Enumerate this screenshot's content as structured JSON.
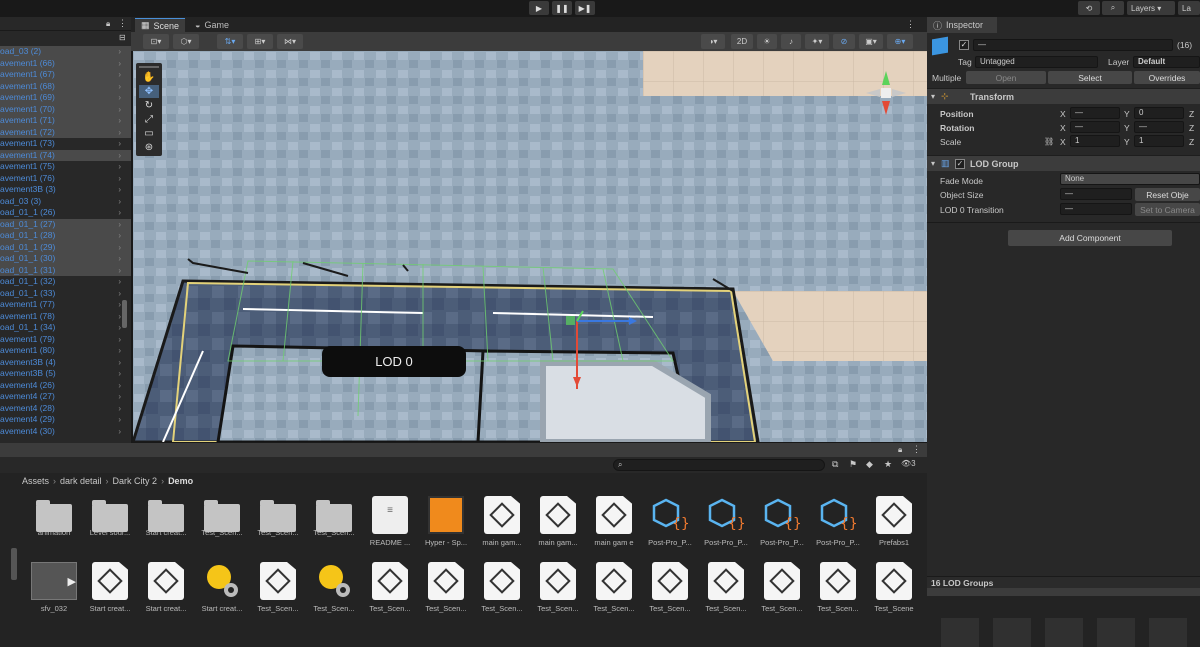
{
  "scene": {
    "tab_scene": "Scene",
    "tab_game": "Game",
    "lod_badge": "LOD 0",
    "btn_2d": "2D"
  },
  "toolbar": {
    "layers": "Layers",
    "layout": "La"
  },
  "hierarchy": {
    "items": [
      {
        "label": "oad_03 (2)",
        "sel": true
      },
      {
        "label": "avement1 (66)",
        "sel": true
      },
      {
        "label": "avement1 (67)",
        "sel": true
      },
      {
        "label": "avement1 (68)",
        "sel": true
      },
      {
        "label": "avement1 (69)",
        "sel": true
      },
      {
        "label": "avement1 (70)",
        "sel": true
      },
      {
        "label": "avement1 (71)",
        "sel": true
      },
      {
        "label": "avement1 (72)",
        "sel": true
      },
      {
        "label": "avement1 (73)",
        "sel": false
      },
      {
        "label": "avement1 (74)",
        "sel": true
      },
      {
        "label": "avement1 (75)",
        "sel": false
      },
      {
        "label": "avement1 (76)",
        "sel": false
      },
      {
        "label": "avement3B (3)",
        "sel": false
      },
      {
        "label": "oad_03 (3)",
        "sel": false
      },
      {
        "label": "oad_01_1 (26)",
        "sel": false
      },
      {
        "label": "oad_01_1 (27)",
        "sel": true
      },
      {
        "label": "oad_01_1 (28)",
        "sel": true
      },
      {
        "label": "oad_01_1 (29)",
        "sel": true
      },
      {
        "label": "oad_01_1 (30)",
        "sel": true
      },
      {
        "label": "oad_01_1 (31)",
        "sel": true
      },
      {
        "label": "oad_01_1 (32)",
        "sel": false
      },
      {
        "label": "oad_01_1 (33)",
        "sel": false
      },
      {
        "label": "avement1 (77)",
        "sel": false
      },
      {
        "label": "avement1 (78)",
        "sel": false
      },
      {
        "label": "oad_01_1 (34)",
        "sel": false
      },
      {
        "label": "avement1 (79)",
        "sel": false
      },
      {
        "label": "avement1 (80)",
        "sel": false
      },
      {
        "label": "avement3B (4)",
        "sel": false
      },
      {
        "label": "avement3B (5)",
        "sel": false
      },
      {
        "label": "avement4 (26)",
        "sel": false
      },
      {
        "label": "avement4 (27)",
        "sel": false
      },
      {
        "label": "avement4 (28)",
        "sel": false
      },
      {
        "label": "avement4 (29)",
        "sel": false
      },
      {
        "label": "avement4 (30)",
        "sel": false
      }
    ]
  },
  "inspector": {
    "tab": "Inspector",
    "name_value": "—",
    "count": "(16)",
    "tag_label": "Tag",
    "tag_value": "Untagged",
    "layer_label": "Layer",
    "layer_value": "Default",
    "multiple": "Multiple",
    "open": "Open",
    "select": "Select",
    "overrides": "Overrides",
    "transform": "Transform",
    "position": "Position",
    "rotation": "Rotation",
    "scale": "Scale",
    "x": "X",
    "y": "Y",
    "z": "Z",
    "pos_x": "—",
    "pos_y": "0",
    "rot_x": "—",
    "rot_y": "—",
    "scale_x": "1",
    "scale_y": "1",
    "lod_group": "LOD Group",
    "fade_mode": "Fade Mode",
    "fade_value": "None",
    "object_size": "Object Size",
    "object_size_value": "—",
    "reset": "Reset Obje",
    "lod0_transition": "LOD 0 Transition",
    "lod0_value": "—",
    "set_camera": "Set to Camera",
    "add_component": "Add Component",
    "lod_groups_count": "16 LOD Groups"
  },
  "project": {
    "breadcrumb": [
      "Assets",
      "dark detail",
      "Dark City 2",
      "Demo"
    ],
    "filter_count": "3",
    "row1": [
      {
        "label": "animation",
        "kind": "folder"
      },
      {
        "label": "Level sour...",
        "kind": "folder"
      },
      {
        "label": "Start creat...",
        "kind": "folder"
      },
      {
        "label": "Test_Scen...",
        "kind": "folder"
      },
      {
        "label": "Test_Scen...",
        "kind": "folder"
      },
      {
        "label": "Test_Scen...",
        "kind": "folder"
      },
      {
        "label": "README ...",
        "kind": "doc"
      },
      {
        "label": "Hyper - Sp...",
        "kind": "sprite"
      },
      {
        "label": "main gam...",
        "kind": "unity"
      },
      {
        "label": "main gam...",
        "kind": "unity"
      },
      {
        "label": "main gam e",
        "kind": "unity"
      },
      {
        "label": "Post-Pro_P...",
        "kind": "post"
      },
      {
        "label": "Post-Pro_P...",
        "kind": "post"
      },
      {
        "label": "Post-Pro_P...",
        "kind": "post"
      },
      {
        "label": "Post-Pro_P...",
        "kind": "post"
      },
      {
        "label": "Prefabs1",
        "kind": "unity"
      }
    ],
    "row2": [
      {
        "label": "sfv_032",
        "kind": "video"
      },
      {
        "label": "Start creat...",
        "kind": "unity"
      },
      {
        "label": "Start creat...",
        "kind": "unity"
      },
      {
        "label": "Start creat...",
        "kind": "light"
      },
      {
        "label": "Test_Scen...",
        "kind": "unity"
      },
      {
        "label": "Test_Scen...",
        "kind": "light"
      },
      {
        "label": "Test_Scen...",
        "kind": "unity"
      },
      {
        "label": "Test_Scen...",
        "kind": "unity"
      },
      {
        "label": "Test_Scen...",
        "kind": "unity"
      },
      {
        "label": "Test_Scen...",
        "kind": "unity"
      },
      {
        "label": "Test_Scen...",
        "kind": "unity"
      },
      {
        "label": "Test_Scen...",
        "kind": "unity"
      },
      {
        "label": "Test_Scen...",
        "kind": "unity"
      },
      {
        "label": "Test_Scen...",
        "kind": "unity"
      },
      {
        "label": "Test_Scen...",
        "kind": "unity"
      },
      {
        "label": "Test_Scene",
        "kind": "unity"
      }
    ]
  }
}
